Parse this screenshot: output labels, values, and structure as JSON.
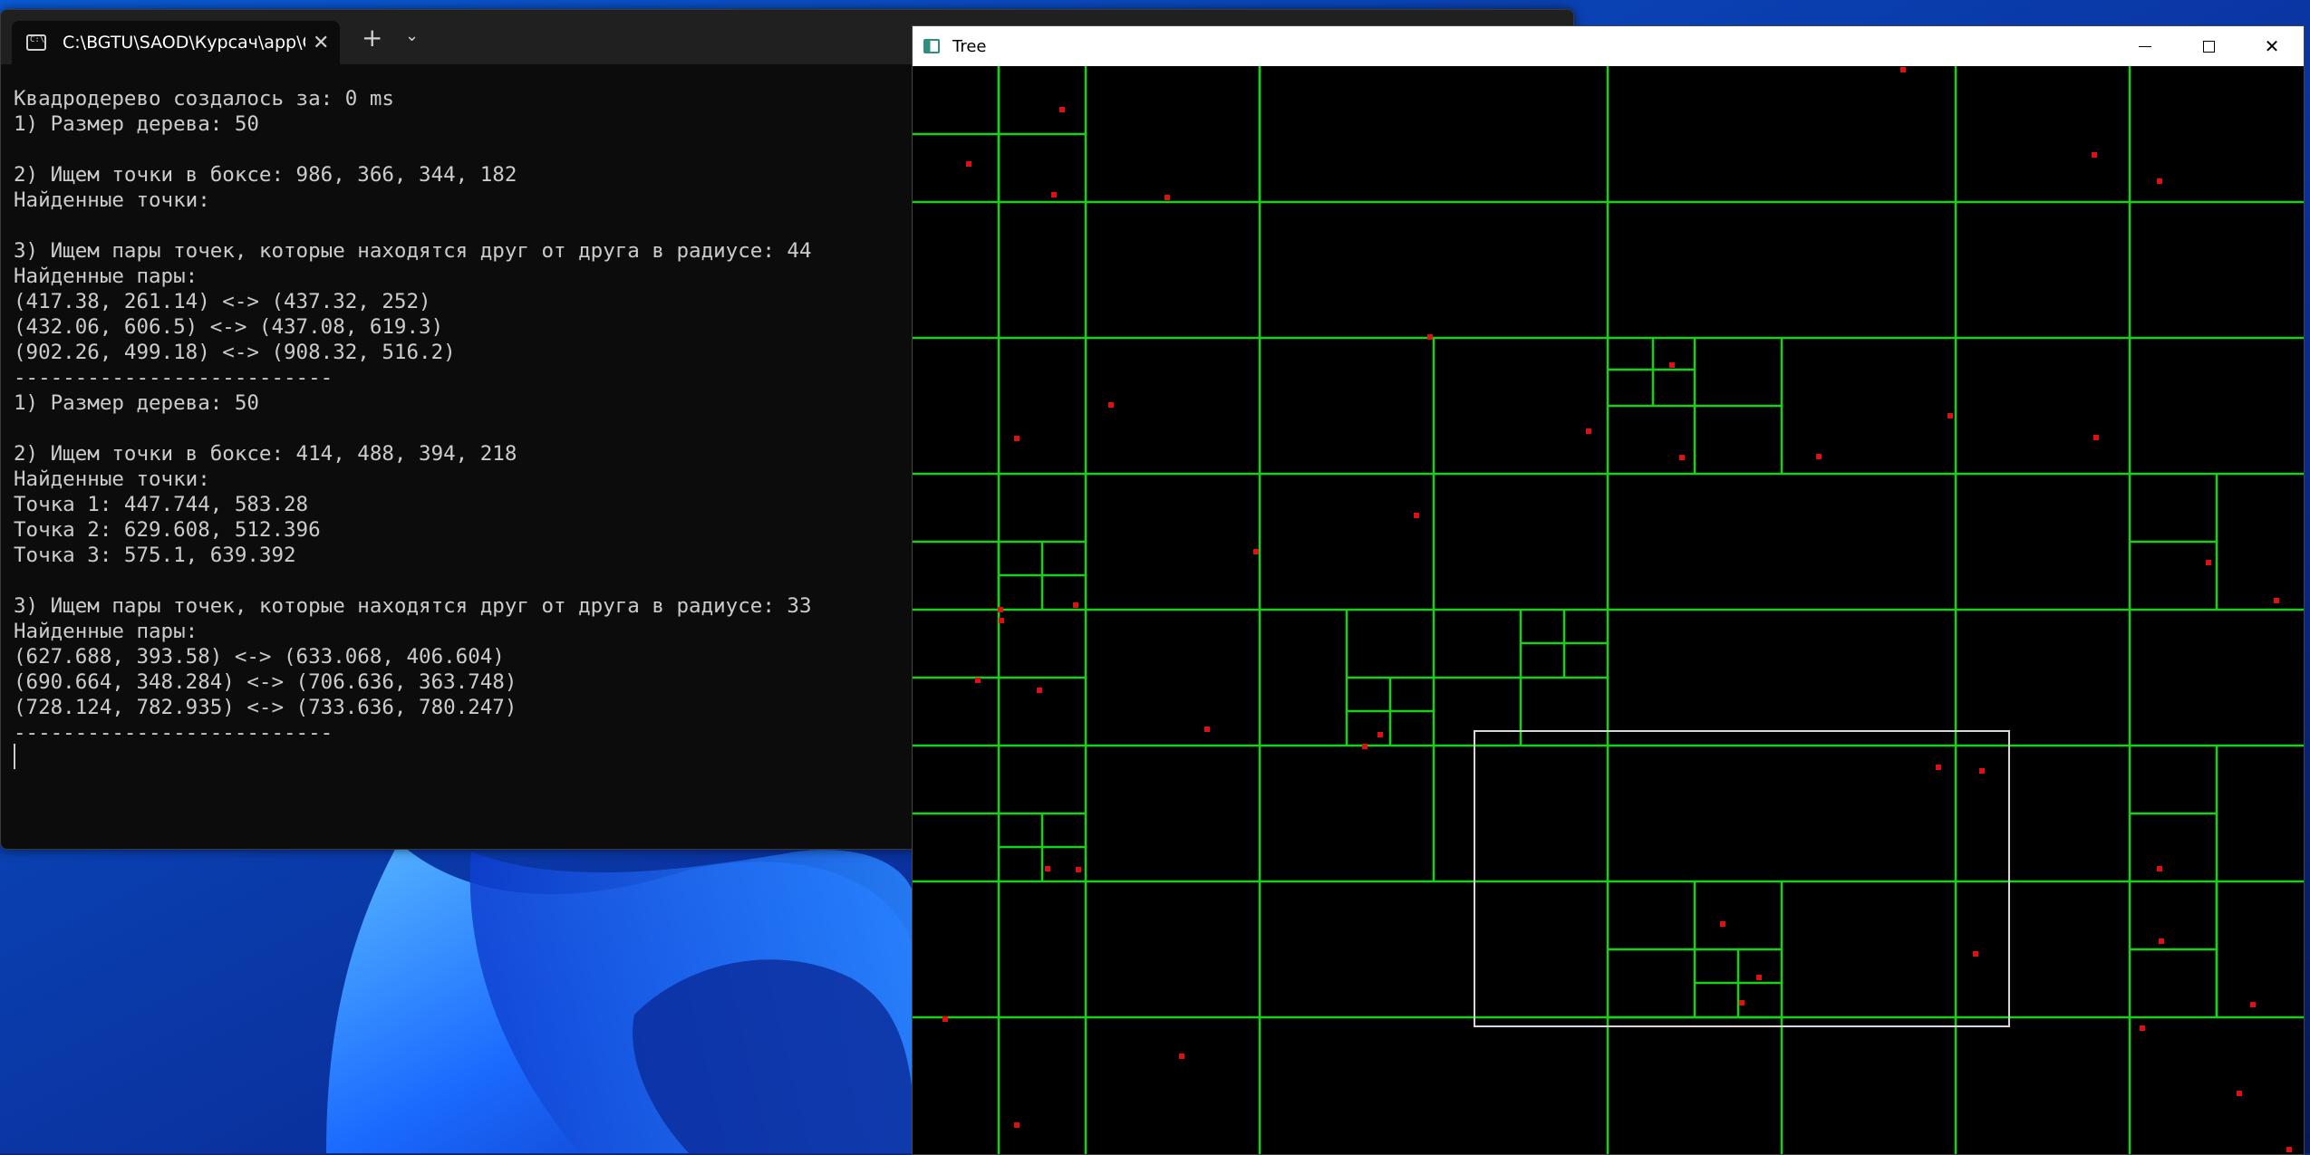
{
  "terminal": {
    "tab_title": "C:\\BGTU\\SAOD\\Курсач\\app\\C",
    "tab_close": "✕",
    "new_tab": "+",
    "dropdown": "⌄",
    "lines": [
      "Квадродерево создалось за: 0 ms",
      "1) Размер дерева: 50",
      "",
      "2) Ищем точки в боксе: 986, 366, 344, 182",
      "Найденные точки:",
      "",
      "3) Ищем пары точек, которые находятся друг от друга в радиусе: 44",
      "Найденные пары:",
      "(417.38, 261.14) <-> (437.32, 252)",
      "(432.06, 606.5) <-> (437.08, 619.3)",
      "(902.26, 499.18) <-> (908.32, 516.2)",
      "--------------------------",
      "1) Размер дерева: 50",
      "",
      "2) Ищем точки в боксе: 414, 488, 394, 218",
      "Найденные точки:",
      "Точка 1: 447.744, 583.28",
      "Точка 2: 629.608, 512.396",
      "Точка 3: 575.1, 639.392",
      "",
      "3) Ищем пары точек, которые находятся друг от друга в радиусе: 33",
      "Найденные пары:",
      "(627.688, 393.58) <-> (633.068, 406.604)",
      "(690.664, 348.284) <-> (706.636, 363.748)",
      "(728.124, 782.935) <-> (733.636, 780.247)",
      "--------------------------"
    ]
  },
  "tree_window": {
    "title": "Tree",
    "minimize_label": "",
    "maximize_label": "",
    "close_label": "✕",
    "colors": {
      "background": "#000000",
      "grid": "#19d119",
      "point": "#e01010",
      "query_box": "#d8d8d8"
    }
  }
}
